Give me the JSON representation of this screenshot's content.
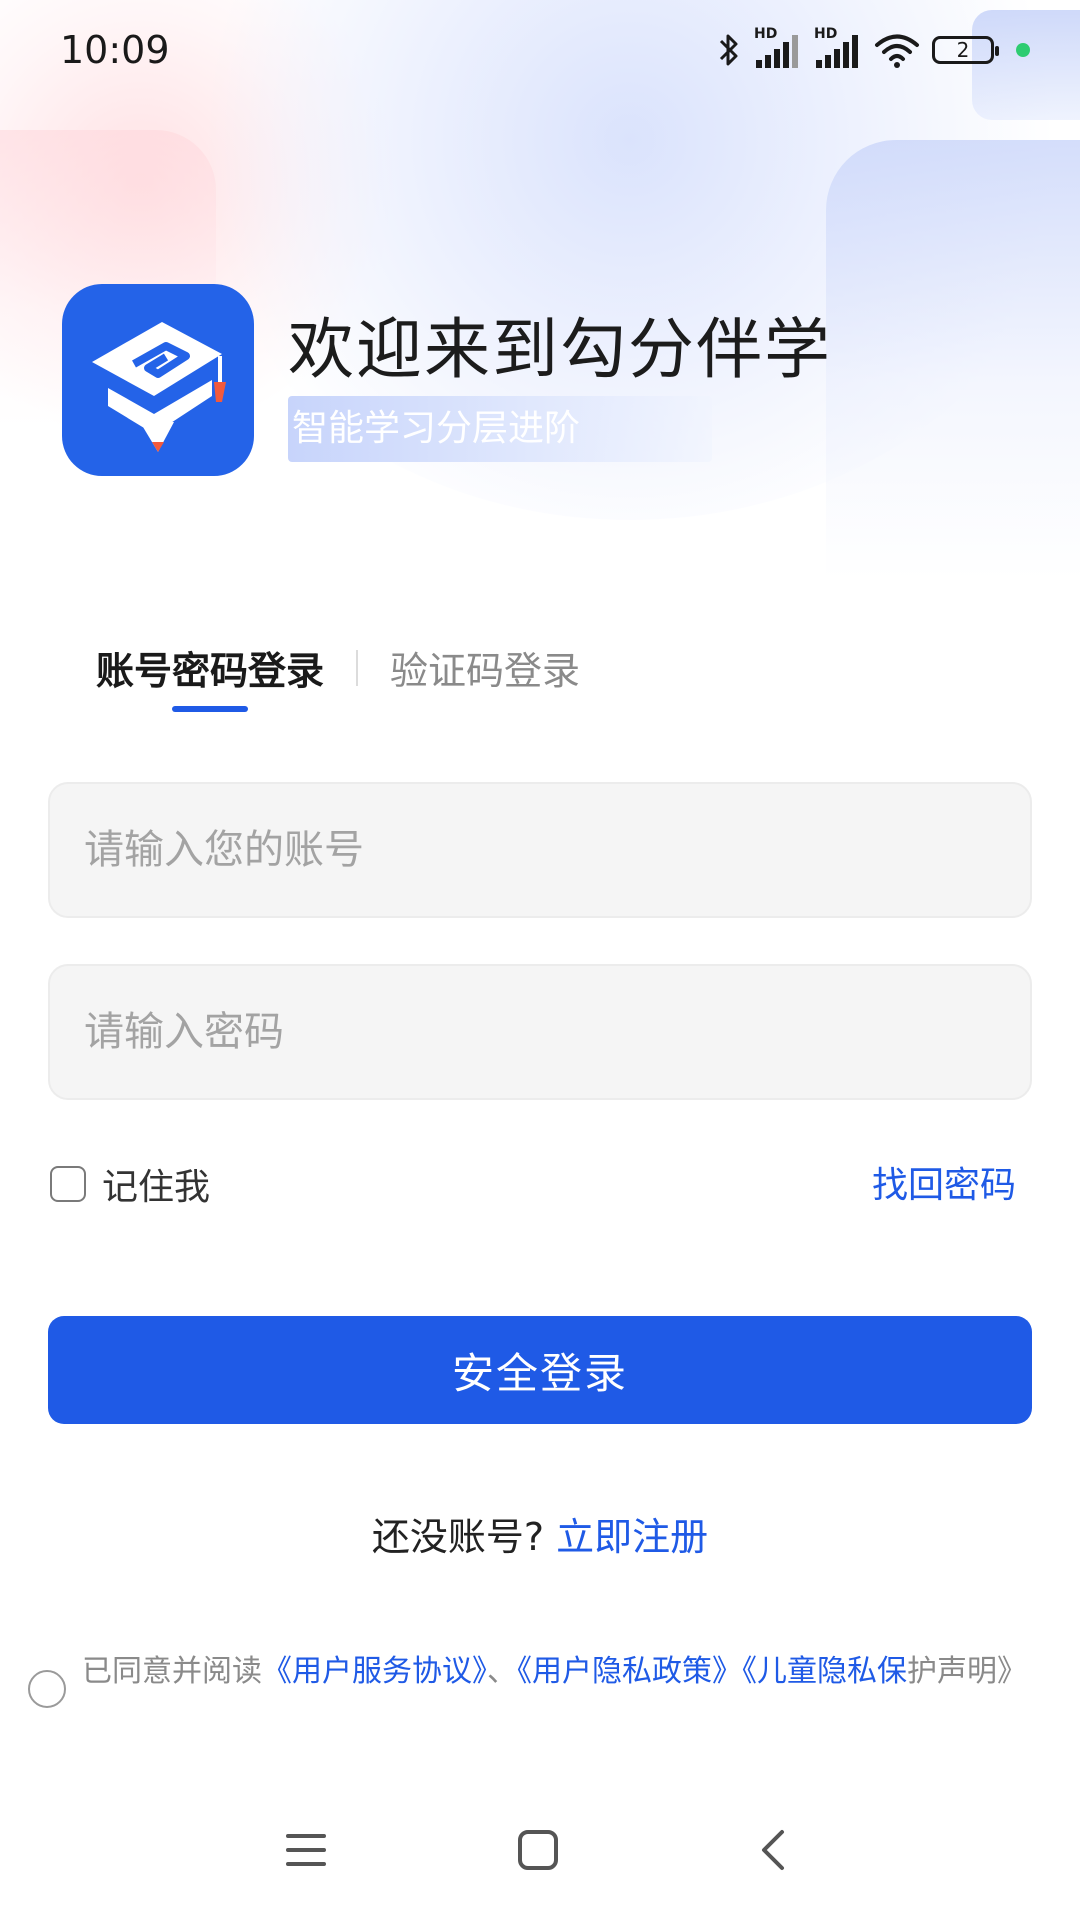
{
  "status_bar": {
    "time": "10:09",
    "network_label_1": "HD",
    "network_label_2": "HD",
    "battery_level": "2",
    "icons": [
      "bluetooth-icon",
      "signal-icon",
      "signal-icon",
      "wifi-icon",
      "battery-icon"
    ]
  },
  "header": {
    "app_logo": "app-logo-icon",
    "title": "欢迎来到勾分伴学",
    "subtitle": "智能学习分层进阶"
  },
  "tabs": [
    {
      "label": "账号密码登录",
      "active": true
    },
    {
      "label": "验证码登录",
      "active": false
    }
  ],
  "form": {
    "account_placeholder": "请输入您的账号",
    "account_value": "",
    "password_placeholder": "请输入密码",
    "password_value": "",
    "remember_label": "记住我",
    "remember_checked": false,
    "forgot_label": "找回密码",
    "submit_label": "安全登录"
  },
  "register": {
    "prompt": "还没账号?",
    "link_label": "立即注册"
  },
  "agreement": {
    "checked": false,
    "prefix": "已同意并阅读",
    "doc_1": "《用户服务协议》",
    "separator": "、",
    "doc_2": "《用户隐私政策》",
    "doc_3_part1": "《儿童隐私保",
    "doc_3_part2": "护声明》"
  },
  "nav_bar": {
    "buttons": [
      "menu-icon",
      "home-icon",
      "back-icon"
    ]
  },
  "colors": {
    "accent": "#1f5ae6",
    "logo_bg": "#2463e8",
    "input_bg": "#f5f5f5",
    "placeholder": "#a3a3a3"
  }
}
